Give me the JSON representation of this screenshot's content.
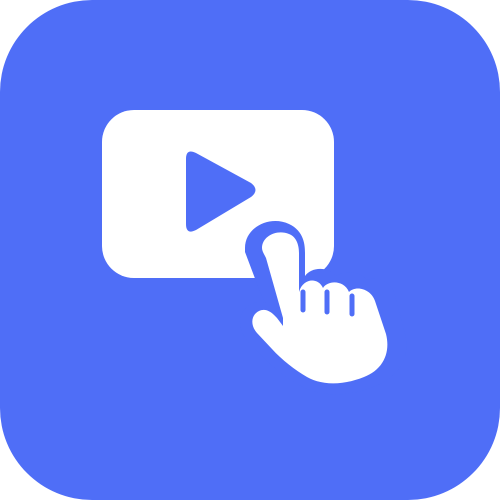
{
  "icon": {
    "name": "video-play-tap-icon",
    "background_color": "#4f6ef7",
    "foreground_color": "#ffffff"
  }
}
